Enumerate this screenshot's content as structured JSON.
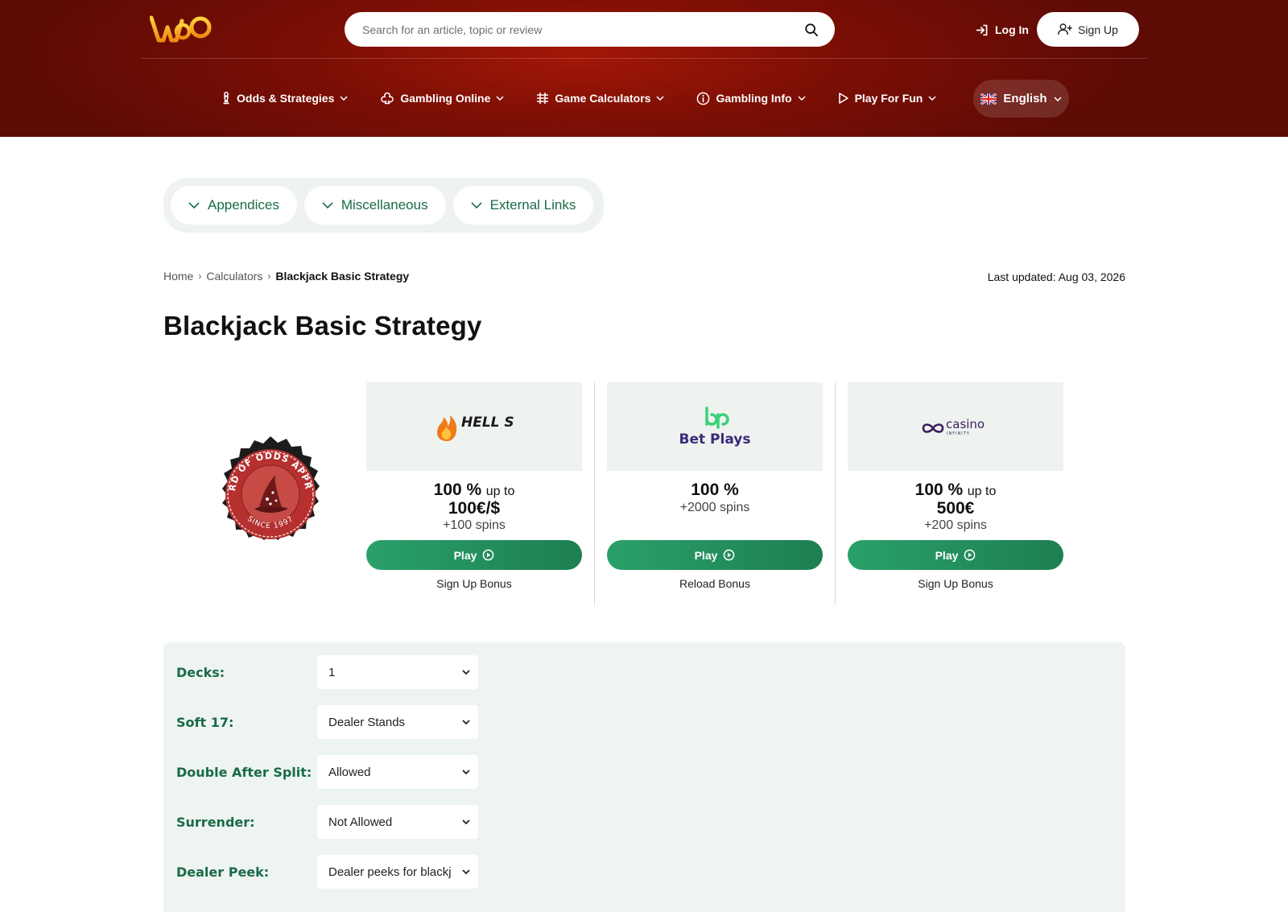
{
  "header": {
    "logo_text": "WoO",
    "search_placeholder": "Search for an article, topic or review",
    "login_label": "Log In",
    "signup_label": "Sign Up"
  },
  "nav": {
    "items": [
      {
        "label": "Odds & Strategies",
        "icon": "chess-pawn-icon"
      },
      {
        "label": "Gambling Online",
        "icon": "club-icon"
      },
      {
        "label": "Game Calculators",
        "icon": "calculator-grid-icon"
      },
      {
        "label": "Gambling Info",
        "icon": "info-circle-icon"
      },
      {
        "label": "Play For Fun",
        "icon": "play-triangle-icon"
      }
    ],
    "language": "English"
  },
  "pills": [
    {
      "label": "Appendices"
    },
    {
      "label": "Miscellaneous"
    },
    {
      "label": "External Links"
    }
  ],
  "breadcrumb": {
    "home": "Home",
    "calculators": "Calculators",
    "current": "Blackjack Basic Strategy"
  },
  "last_updated": "Last updated: Aug 03, 2026",
  "page_title": "Blackjack Basic Strategy",
  "badge": {
    "text_top": "WIZARD OF ODDS APPROVED",
    "text_bottom": "SINCE 1997"
  },
  "casinos": [
    {
      "name": "HELL SPIN",
      "percent": "100 %",
      "upto": "up to",
      "amount": "100€/$",
      "spins": "+100 spins",
      "play_label": "Play",
      "bonus_type": "Sign Up Bonus"
    },
    {
      "name": "Bet Plays",
      "percent": "100 %",
      "upto": "",
      "amount": "",
      "spins": "+2000 spins",
      "play_label": "Play",
      "bonus_type": "Reload Bonus"
    },
    {
      "name": "casino",
      "subname": "INFINITY",
      "percent": "100 %",
      "upto": "up to",
      "amount": "500€",
      "spins": "+200 spins",
      "play_label": "Play",
      "bonus_type": "Sign Up Bonus"
    }
  ],
  "settings": [
    {
      "label": "Decks:",
      "value": "1"
    },
    {
      "label": "Soft 17:",
      "value": "Dealer Stands"
    },
    {
      "label": "Double After Split:",
      "value": "Allowed"
    },
    {
      "label": "Surrender:",
      "value": "Not Allowed"
    },
    {
      "label": "Dealer Peek:",
      "value": "Dealer peeks for blackj"
    }
  ],
  "colors": {
    "header_red": "#7d0f05",
    "accent_green": "#1a6b47",
    "play_green": "#23925f",
    "panel_bg": "#eef4f2"
  }
}
